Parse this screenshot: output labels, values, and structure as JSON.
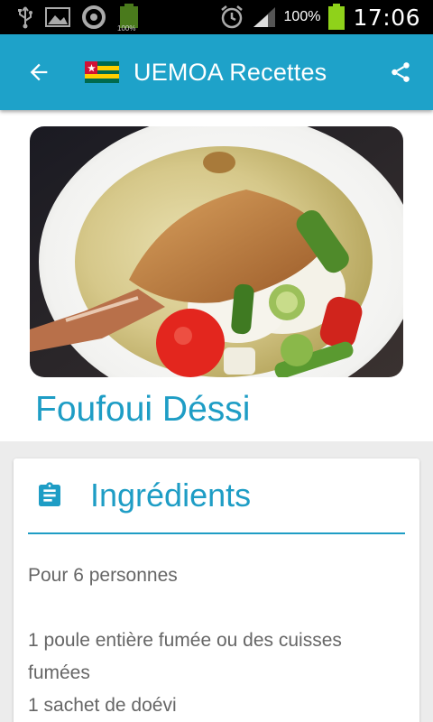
{
  "status_bar": {
    "battery_pct": "100%",
    "time": "17:06",
    "notif_battery_label": "100%"
  },
  "app_bar": {
    "title": "UEMOA Recettes"
  },
  "recipe": {
    "title": "Foufoui Déssi"
  },
  "ingredients": {
    "heading": "Ingrédients",
    "servings": "Pour 6 personnes",
    "items": [
      "1 poule entière fumée ou des cuisses fumées",
      "1 sachet de doévi"
    ]
  },
  "colors": {
    "accent": "#1ea2c9",
    "title_text": "#1e9dc5",
    "body_text": "#666666",
    "background": "#ececec"
  },
  "icons": {
    "back": "arrow-left-icon",
    "share": "share-icon",
    "ingredients": "clipboard-icon",
    "flag": "togo-flag-icon"
  }
}
